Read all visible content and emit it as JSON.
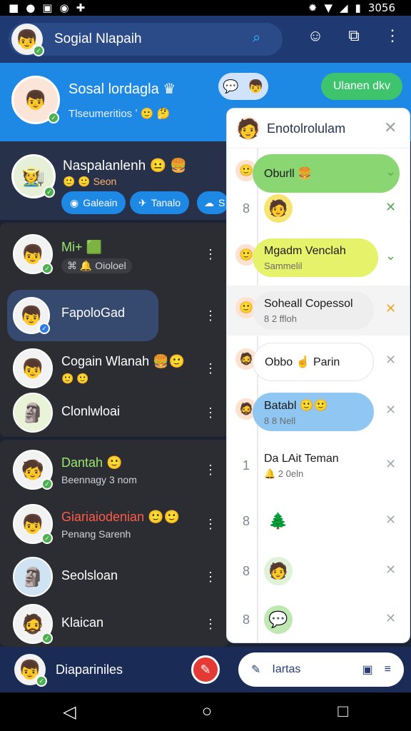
{
  "status": {
    "time": "3056"
  },
  "search": {
    "title": "Sogial Nlapaih"
  },
  "hero": {
    "name": "Sosal lordagla ♛",
    "subtitle": "Tlseumeritios ʼ 🙂 🤔",
    "button": "Ulanen dkv"
  },
  "group": {
    "name": "Naspalanlenh 😐 🍔",
    "meta": "🙂 🙂 Seon",
    "pills": [
      "Galeain",
      "Tanalo",
      "S"
    ]
  },
  "contacts": [
    {
      "title": "Mi+ 🟩",
      "subtitle": "⌘ 🔔 Oioloel"
    },
    {
      "title": "FapoloGad",
      "subtitle": ""
    },
    {
      "title": "Cogain Wlanah 🍔🙂",
      "subtitle": "🙂 🙂"
    },
    {
      "title": "Clonlwloai",
      "subtitle": ""
    }
  ],
  "contacts2": [
    {
      "title": "Dantah 🙂",
      "subtitle": "Beennagy 3 nom"
    },
    {
      "title": "Giariaiodenian 🙂🙂",
      "subtitle": "Penang Sarenh"
    },
    {
      "title": "Seolsloan",
      "subtitle": ""
    },
    {
      "title": "Klaican",
      "subtitle": ""
    }
  ],
  "bottom": {
    "name": "Diapariniles",
    "pill_text": "Iartas"
  },
  "panel": {
    "title": "Enotolrolulam",
    "rows": [
      {
        "num": "",
        "title": "Oburll 🍔",
        "sub": "",
        "style": "green",
        "icon": "🙂"
      },
      {
        "num": "8",
        "title": "",
        "sub": "",
        "style": "",
        "icon": "🧑"
      },
      {
        "num": "",
        "title": "Mgadm Venclah",
        "sub": "Sammelil",
        "style": "yellow",
        "icon": "🙂"
      },
      {
        "num": "",
        "title": "Soheall Copessol",
        "sub": "8 2 ffloh",
        "style": "gray",
        "icon": "🙂"
      },
      {
        "num": "",
        "title": "Obbo ☝ Parin",
        "sub": "",
        "style": "white",
        "icon": "🧔"
      },
      {
        "num": "",
        "title": "Batabl 🙂🙂",
        "sub": "8 8 Nell",
        "style": "blue",
        "icon": "🧔"
      },
      {
        "num": "1",
        "title": "Da LAit Teman",
        "sub": "🔔 2 0eln",
        "style": "",
        "icon": ""
      },
      {
        "num": "8",
        "title": "",
        "sub": "",
        "style": "",
        "icon": "🌲"
      },
      {
        "num": "8",
        "title": "",
        "sub": "",
        "style": "",
        "icon": "🧑"
      },
      {
        "num": "8",
        "title": "",
        "sub": "",
        "style": "",
        "icon": "💬"
      }
    ]
  }
}
